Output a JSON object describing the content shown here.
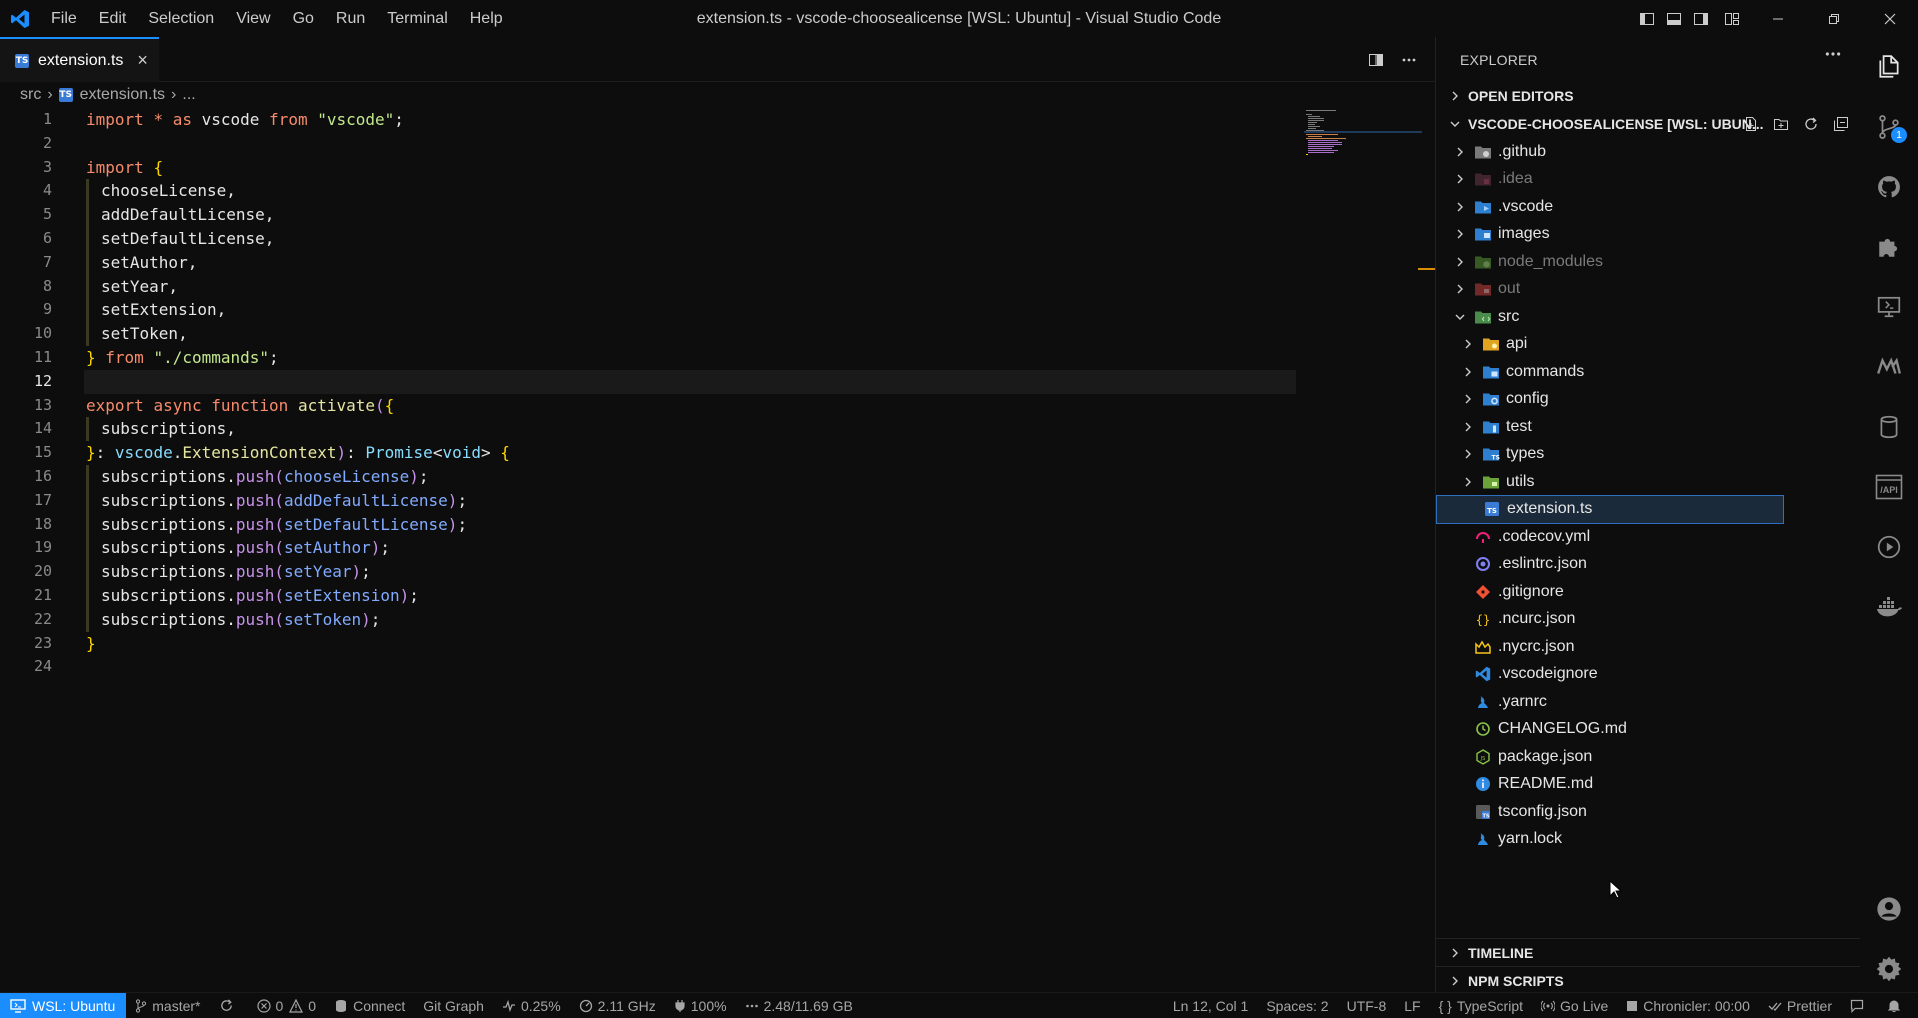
{
  "window": {
    "title": "extension.ts - vscode-choosealicense [WSL: Ubuntu] - Visual Studio Code",
    "menu": [
      "File",
      "Edit",
      "Selection",
      "View",
      "Go",
      "Run",
      "Terminal",
      "Help"
    ]
  },
  "tab": {
    "label": "extension.ts",
    "badge": "TS"
  },
  "breadcrumb": {
    "folder": "src",
    "file": "extension.ts",
    "more": "..."
  },
  "editor": {
    "active_line": 12,
    "line_numbers": [
      "1",
      "2",
      "3",
      "4",
      "5",
      "6",
      "7",
      "8",
      "9",
      "10",
      "11",
      "12",
      "13",
      "14",
      "15",
      "16",
      "17",
      "18",
      "19",
      "20",
      "21",
      "22",
      "23",
      "24"
    ]
  },
  "explorer": {
    "header": "EXPLORER",
    "open_editors": "OPEN EDITORS",
    "folder_name": "VSCODE-CHOOSEALICENSE [WSL: UBUN...",
    "items": [
      {
        "label": ".github",
        "type": "folder",
        "icon": "github-folder-icon",
        "dim": false,
        "depth": 0,
        "expanded": false
      },
      {
        "label": ".idea",
        "type": "folder",
        "icon": "idea-folder-icon",
        "dim": true,
        "depth": 0,
        "expanded": false
      },
      {
        "label": ".vscode",
        "type": "folder",
        "icon": "vscode-folder-icon",
        "dim": false,
        "depth": 0,
        "expanded": false
      },
      {
        "label": "images",
        "type": "folder",
        "icon": "images-folder-icon",
        "dim": false,
        "depth": 0,
        "expanded": false
      },
      {
        "label": "node_modules",
        "type": "folder",
        "icon": "node-folder-icon",
        "dim": true,
        "depth": 0,
        "expanded": false
      },
      {
        "label": "out",
        "type": "folder",
        "icon": "out-folder-icon",
        "dim": true,
        "depth": 0,
        "expanded": false
      },
      {
        "label": "src",
        "type": "folder",
        "icon": "src-folder-icon",
        "dim": false,
        "depth": 0,
        "expanded": true
      },
      {
        "label": "api",
        "type": "folder",
        "icon": "api-folder-icon",
        "dim": false,
        "depth": 1,
        "expanded": false
      },
      {
        "label": "commands",
        "type": "folder",
        "icon": "commands-folder-icon",
        "dim": false,
        "depth": 1,
        "expanded": false
      },
      {
        "label": "config",
        "type": "folder",
        "icon": "config-folder-icon",
        "dim": false,
        "depth": 1,
        "expanded": false
      },
      {
        "label": "test",
        "type": "folder",
        "icon": "test-folder-icon",
        "dim": false,
        "depth": 1,
        "expanded": false
      },
      {
        "label": "types",
        "type": "folder",
        "icon": "types-folder-icon",
        "dim": false,
        "depth": 1,
        "expanded": false
      },
      {
        "label": "utils",
        "type": "folder",
        "icon": "utils-folder-icon",
        "dim": false,
        "depth": 1,
        "expanded": false
      },
      {
        "label": "extension.ts",
        "type": "file",
        "icon": "typescript-file-icon",
        "dim": false,
        "depth": 1,
        "selected": true
      },
      {
        "label": ".codecov.yml",
        "type": "file",
        "icon": "codecov-file-icon",
        "dim": false,
        "depth": 0
      },
      {
        "label": ".eslintrc.json",
        "type": "file",
        "icon": "eslint-file-icon",
        "dim": false,
        "depth": 0
      },
      {
        "label": ".gitignore",
        "type": "file",
        "icon": "git-file-icon",
        "dim": false,
        "depth": 0
      },
      {
        "label": ".ncurc.json",
        "type": "file",
        "icon": "json-file-icon",
        "dim": false,
        "depth": 0
      },
      {
        "label": ".nycrc.json",
        "type": "file",
        "icon": "nyc-file-icon",
        "dim": false,
        "depth": 0
      },
      {
        "label": ".vscodeignore",
        "type": "file",
        "icon": "vscode-file-icon",
        "dim": false,
        "depth": 0
      },
      {
        "label": ".yarnrc",
        "type": "file",
        "icon": "yarn-file-icon",
        "dim": false,
        "depth": 0
      },
      {
        "label": "CHANGELOG.md",
        "type": "file",
        "icon": "changelog-file-icon",
        "dim": false,
        "depth": 0
      },
      {
        "label": "package.json",
        "type": "file",
        "icon": "npm-file-icon",
        "dim": false,
        "depth": 0
      },
      {
        "label": "README.md",
        "type": "file",
        "icon": "readme-file-icon",
        "dim": false,
        "depth": 0
      },
      {
        "label": "tsconfig.json",
        "type": "file",
        "icon": "tsconfig-file-icon",
        "dim": false,
        "depth": 0
      },
      {
        "label": "yarn.lock",
        "type": "file",
        "icon": "yarn-file-icon",
        "dim": false,
        "depth": 0
      }
    ],
    "timeline": "TIMELINE",
    "npm_scripts": "NPM SCRIPTS"
  },
  "activity_bar": {
    "source_control_badge": "1",
    "api_label": "/API"
  },
  "status": {
    "remote": "WSL: Ubuntu",
    "branch": "master*",
    "errors": "0",
    "warnings": "0",
    "connect": "Connect",
    "git_graph": "Git Graph",
    "cpu": "0.25%",
    "freq": "2.11 GHz",
    "battery": "100%",
    "memory": "2.48/11.69 GB",
    "position": "Ln 12, Col 1",
    "spaces": "Spaces: 2",
    "encoding": "UTF-8",
    "eol": "LF",
    "language": "TypeScript",
    "go_live": "Go Live",
    "chronicler": "Chronicler: 00:00",
    "prettier": "Prettier"
  },
  "colors": {
    "accent": "#1a8dff",
    "background": "#0d0d0d",
    "selection_outline": "#2f6fbd"
  }
}
